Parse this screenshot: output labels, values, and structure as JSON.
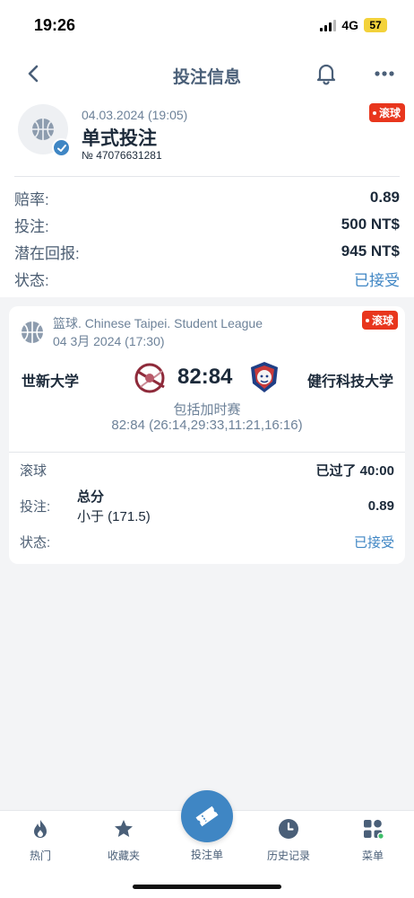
{
  "status_bar": {
    "time": "19:26",
    "network": "4G",
    "battery": "57"
  },
  "nav": {
    "title": "投注信息",
    "back_icon": "chevron-left-icon",
    "bell_icon": "bell-icon",
    "more_icon": "more-dots-icon"
  },
  "bet": {
    "date": "04.03.2024 (19:05)",
    "type": "单式投注",
    "number": "№ 47076631281",
    "live_badge": "滚球",
    "sport_icon": "basketball-icon"
  },
  "summary": [
    {
      "label": "赔率:",
      "value": "0.89"
    },
    {
      "label": "投注:",
      "value": "500 NT$"
    },
    {
      "label": "潜在回报:",
      "value": "945 NT$"
    },
    {
      "label": "状态:",
      "value": "已接受"
    }
  ],
  "event": {
    "league": "篮球. Chinese Taipei. Student League",
    "date": "04 3月 2024 (17:30)",
    "live_badge": "滚球",
    "home_team": "世新大学",
    "away_team": "健行科技大学",
    "score": "82:84",
    "overtime": "包括加时赛",
    "periods": "82:84 (26:14,29:33,11:21,16:16)",
    "live_label": "滚球",
    "time_elapsed": "已过了 40:00",
    "bet_label": "投注:",
    "market": "总分",
    "outcome": "小于 (171.5)",
    "odds": "0.89",
    "status_label": "状态:",
    "status_value": "已接受"
  },
  "tabbar": {
    "tabs": [
      {
        "label": "热门",
        "icon": "flame-icon"
      },
      {
        "label": "收藏夹",
        "icon": "star-icon"
      },
      {
        "label": "投注单",
        "icon": "ticket-icon"
      },
      {
        "label": "历史记录",
        "icon": "clock-icon"
      },
      {
        "label": "菜单",
        "icon": "grid-menu-icon"
      }
    ]
  },
  "colors": {
    "accent": "#3f86c4",
    "live": "#e8361d",
    "text": "#1c2a3a",
    "muted": "#6d8299"
  }
}
